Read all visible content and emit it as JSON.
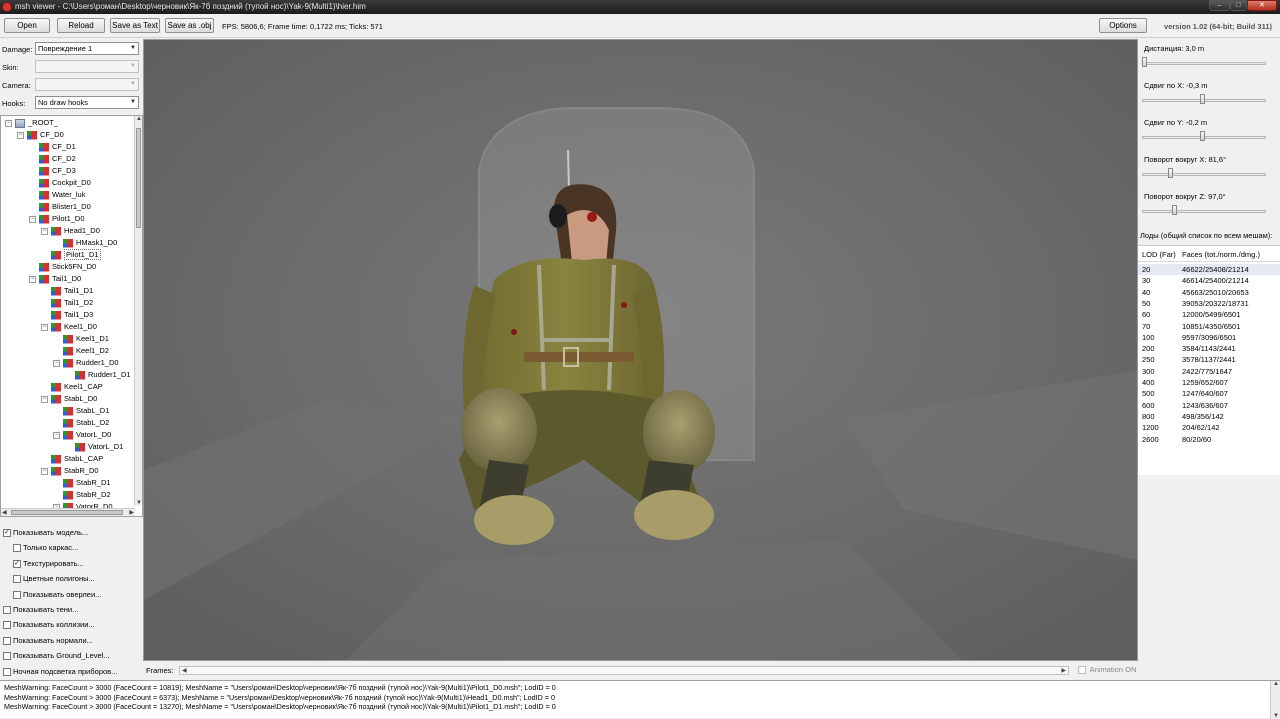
{
  "window": {
    "title": "msh viewer - C:\\Users\\роман\\Desktop\\черновик\\Як-7б поздний (тупой нос)\\Yak-9(Multi1)\\hier.him",
    "controls": [
      "–",
      "□",
      "✕"
    ]
  },
  "toolbar": {
    "open_label": "Open",
    "reload_label": "Reload",
    "save_text_label": "Save as Text",
    "save_obj_label": "Save as .obj",
    "stats": "FPS: 5806,6; Frame time: 0,1722 ms; Ticks: 571",
    "options_label": "Options",
    "version": "version 1.02 (64-bit; Build 311)"
  },
  "left": {
    "damage_label": "Damage:",
    "damage_value": "Повреждение 1",
    "skin_label": "Skin:",
    "skin_value": "",
    "camera_label": "Camera:",
    "camera_value": "",
    "hooks_label": "Hooks:",
    "hooks_value": "No draw hooks",
    "tree": [
      {
        "label": "_ROOT_",
        "level": 0,
        "exp": "−",
        "root": true
      },
      {
        "label": "CF_D0",
        "level": 1,
        "exp": "−"
      },
      {
        "label": "CF_D1",
        "level": 2,
        "exp": ""
      },
      {
        "label": "CF_D2",
        "level": 2,
        "exp": ""
      },
      {
        "label": "CF_D3",
        "level": 2,
        "exp": ""
      },
      {
        "label": "Cockpit_D0",
        "level": 2,
        "exp": ""
      },
      {
        "label": "Water_luk",
        "level": 2,
        "exp": ""
      },
      {
        "label": "Blister1_D0",
        "level": 2,
        "exp": ""
      },
      {
        "label": "Pilot1_D0",
        "level": 2,
        "exp": "−"
      },
      {
        "label": "Head1_D0",
        "level": 3,
        "exp": "−"
      },
      {
        "label": "HMask1_D0",
        "level": 4,
        "exp": ""
      },
      {
        "label": "Pilot1_D1",
        "level": 3,
        "exp": "",
        "sel": true
      },
      {
        "label": "Stick5FN_D0",
        "level": 2,
        "exp": ""
      },
      {
        "label": "Tail1_D0",
        "level": 2,
        "exp": "−"
      },
      {
        "label": "Tail1_D1",
        "level": 3,
        "exp": ""
      },
      {
        "label": "Tail1_D2",
        "level": 3,
        "exp": ""
      },
      {
        "label": "Tail1_D3",
        "level": 3,
        "exp": ""
      },
      {
        "label": "Keel1_D0",
        "level": 3,
        "exp": "−"
      },
      {
        "label": "Keel1_D1",
        "level": 4,
        "exp": ""
      },
      {
        "label": "Keel1_D2",
        "level": 4,
        "exp": ""
      },
      {
        "label": "Rudder1_D0",
        "level": 4,
        "exp": "−"
      },
      {
        "label": "Rudder1_D1",
        "level": 5,
        "exp": ""
      },
      {
        "label": "Keel1_CAP",
        "level": 3,
        "exp": ""
      },
      {
        "label": "StabL_D0",
        "level": 3,
        "exp": "−"
      },
      {
        "label": "StabL_D1",
        "level": 4,
        "exp": ""
      },
      {
        "label": "StabL_D2",
        "level": 4,
        "exp": ""
      },
      {
        "label": "VatorL_D0",
        "level": 4,
        "exp": "−"
      },
      {
        "label": "VatorL_D1",
        "level": 5,
        "exp": ""
      },
      {
        "label": "StabL_CAP",
        "level": 3,
        "exp": ""
      },
      {
        "label": "StabR_D0",
        "level": 3,
        "exp": "−"
      },
      {
        "label": "StabR_D1",
        "level": 4,
        "exp": ""
      },
      {
        "label": "StabR_D2",
        "level": 4,
        "exp": ""
      },
      {
        "label": "VatorR_D0",
        "level": 4,
        "exp": "−"
      }
    ],
    "checks": [
      {
        "label": "Показывать модель...",
        "checked": true,
        "indent": 0
      },
      {
        "label": "Только каркас...",
        "checked": false,
        "indent": 1
      },
      {
        "label": "Текстурировать...",
        "checked": true,
        "indent": 1
      },
      {
        "label": "Цветные полигоны...",
        "checked": false,
        "indent": 1
      },
      {
        "label": "Показывать оверлеи...",
        "checked": false,
        "indent": 1
      },
      {
        "label": "Показывать тени...",
        "checked": false,
        "indent": 0
      },
      {
        "label": "Показывать коллизии...",
        "checked": false,
        "indent": 0
      },
      {
        "label": "Показывать нормали...",
        "checked": false,
        "indent": 0
      },
      {
        "label": "Показывать Ground_Level...",
        "checked": false,
        "indent": 0
      },
      {
        "label": "Ночная подсветка приборов...",
        "checked": false,
        "indent": 0
      }
    ]
  },
  "viewport": {
    "frames_label": "Frames:",
    "animation_label": "Animation ON"
  },
  "right": {
    "params": [
      {
        "label": "Дистанция:  3,0 m",
        "fraction": 0.0
      },
      {
        "label": "Сдвиг по X:  -0,3 m",
        "fraction": 0.49
      },
      {
        "label": "Сдвиг по Y:  -0,2 m",
        "fraction": 0.49
      },
      {
        "label": "Поворот вокруг X:  81,6°",
        "fraction": 0.22
      },
      {
        "label": "Поворот вокруг Z:  97,0°",
        "fraction": 0.25
      }
    ],
    "lods_title": "Лоды (общий список по всем мешам):",
    "lod_headers": [
      "LOD (Far)",
      "Faces (tot./norm./dmg.)"
    ],
    "lods": [
      [
        "20",
        "46622/25408/21214"
      ],
      [
        "30",
        "46614/25400/21214"
      ],
      [
        "40",
        "45663/25010/20653"
      ],
      [
        "50",
        "39053/20322/18731"
      ],
      [
        "60",
        "12000/5499/6501"
      ],
      [
        "70",
        "10851/4350/6501"
      ],
      [
        "100",
        "9597/3096/6501"
      ],
      [
        "200",
        "3584/1143/2441"
      ],
      [
        "250",
        "3578/1137/2441"
      ],
      [
        "300",
        "2422/775/1647"
      ],
      [
        "400",
        "1259/652/607"
      ],
      [
        "500",
        "1247/640/607"
      ],
      [
        "600",
        "1243/636/607"
      ],
      [
        "800",
        "498/356/142"
      ],
      [
        "1200",
        "204/62/142"
      ],
      [
        "2600",
        "80/20/60"
      ]
    ]
  },
  "log": [
    "MeshWarning: FaceCount > 3000 (FaceCount = 10819); MeshName = \"Users\\роман\\Desktop\\черновик\\Як-7б поздний (тупой нос)\\Yak-9(Multi1)\\Pilot1_D0.msh\"; LodID = 0",
    "MeshWarning: FaceCount > 3000 (FaceCount = 6373); MeshName = \"Users\\роман\\Desktop\\черновик\\Як-7б поздний (тупой нос)\\Yak-9(Multi1)\\Head1_D0.msh\"; LodID = 0",
    "MeshWarning: FaceCount > 3000 (FaceCount = 13270); MeshName = \"Users\\роман\\Desktop\\черновик\\Як-7б поздний (тупой нос)\\Yak-9(Multi1)\\Pilot1_D1.msh\"; LodID = 0"
  ]
}
